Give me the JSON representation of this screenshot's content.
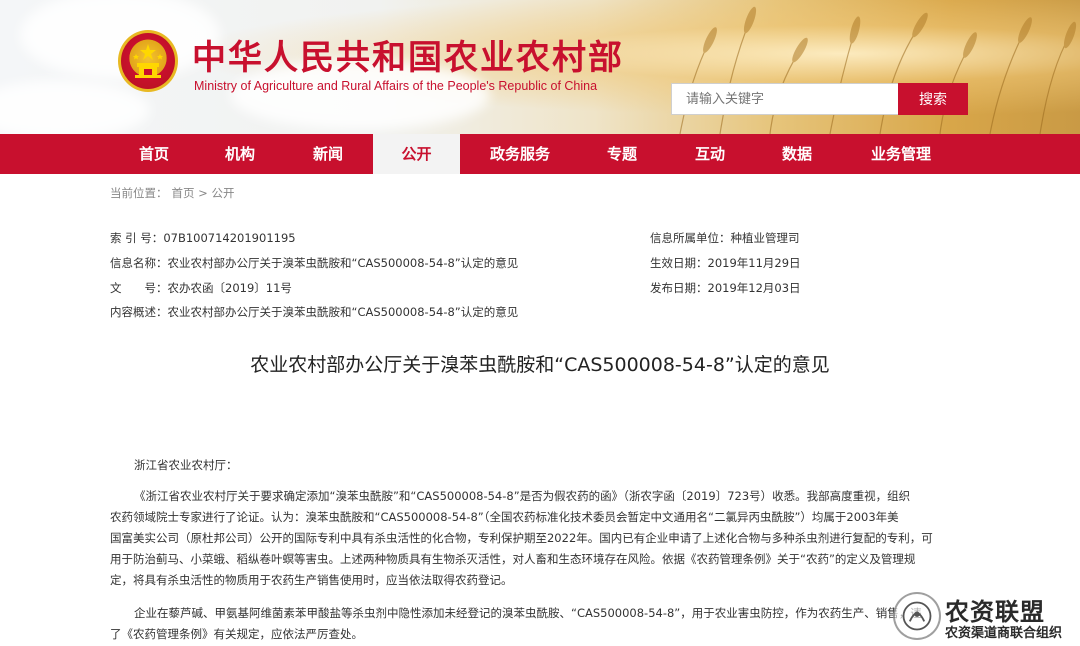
{
  "header": {
    "site_title": "中华人民共和国农业农村部",
    "site_subtitle": "Ministry of Agriculture and Rural Affairs of the People's Republic of China",
    "search_placeholder": "请输入关键字",
    "search_button": "搜索"
  },
  "nav": {
    "items": [
      {
        "label": "首页"
      },
      {
        "label": "机构"
      },
      {
        "label": "新闻"
      },
      {
        "label": "公开",
        "active": true
      },
      {
        "label": "政务服务"
      },
      {
        "label": "专题"
      },
      {
        "label": "互动"
      },
      {
        "label": "数据"
      },
      {
        "label": "业务管理"
      }
    ]
  },
  "breadcrumb": {
    "prefix": "当前位置：",
    "path": "首页 > 公开"
  },
  "info": {
    "index_no_label": "索 引 号：",
    "index_no": "07B100714201901195",
    "info_name_label": "信息名称：",
    "info_name": "农业农村部办公厅关于溴苯虫酰胺和“CAS500008-54-8”认定的意见",
    "doc_no_label": "文　　号：",
    "doc_no": "农办农函〔2019〕11号",
    "summary_label": "内容概述：",
    "summary": "农业农村部办公厅关于溴苯虫酰胺和“CAS500008-54-8”认定的意见",
    "unit_label": "信息所属单位：",
    "unit": "种植业管理司",
    "effective_label": "生效日期：",
    "effective": "2019年11月29日",
    "publish_label": "发布日期：",
    "publish": "2019年12月03日"
  },
  "article": {
    "title": "农业农村部办公厅关于溴苯虫酰胺和“CAS500008-54-8”认定的意见",
    "salutation": "浙江省农业农村厅：",
    "p1_l1": "《浙江省农业农村厅关于要求确定添加“溴苯虫酰胺”和“CAS500008-54-8”是否为假农药的函》（浙农字函〔2019〕723号）收悉。我部高度重视，组织",
    "p1_l2": "农药领域院士专家进行了论证。认为：溴苯虫酰胺和“CAS500008-54-8”（全国农药标准化技术委员会暂定中文通用名“二氯异丙虫酰胺”）均属于2003年美",
    "p1_l3": "国富美实公司（原杜邦公司）公开的国际专利中具有杀虫活性的化合物，专利保护期至2022年。国内已有企业申请了上述化合物与多种杀虫剂进行复配的专利，可",
    "p1_l4": "用于防治蓟马、小菜蛾、稻纵卷叶螟等害虫。上述两种物质具有生物杀灭活性，对人畜和生态环境存在风险。依据《农药管理条例》关于“农药”的定义及管理规",
    "p1_l5": "定，将具有杀虫活性的物质用于农药生产销售使用时，应当依法取得农药登记。",
    "p2_l1": "企业在藜芦碱、甲氨基阿维菌素苯甲酸盐等杀虫剂中隐性添加未经登记的溴苯虫酰胺、“CAS500008-54-8”，用于农业害虫防控，作为农药生产、销售，违",
    "p2_l2": "了《农药管理条例》有关规定，应依法严厉查处。"
  },
  "watermark": {
    "title": "农资联盟",
    "subtitle": "农资渠道商联合组织"
  },
  "colors": {
    "brand_red": "#c8102e",
    "nav_active_bg": "#f3f3f3"
  }
}
